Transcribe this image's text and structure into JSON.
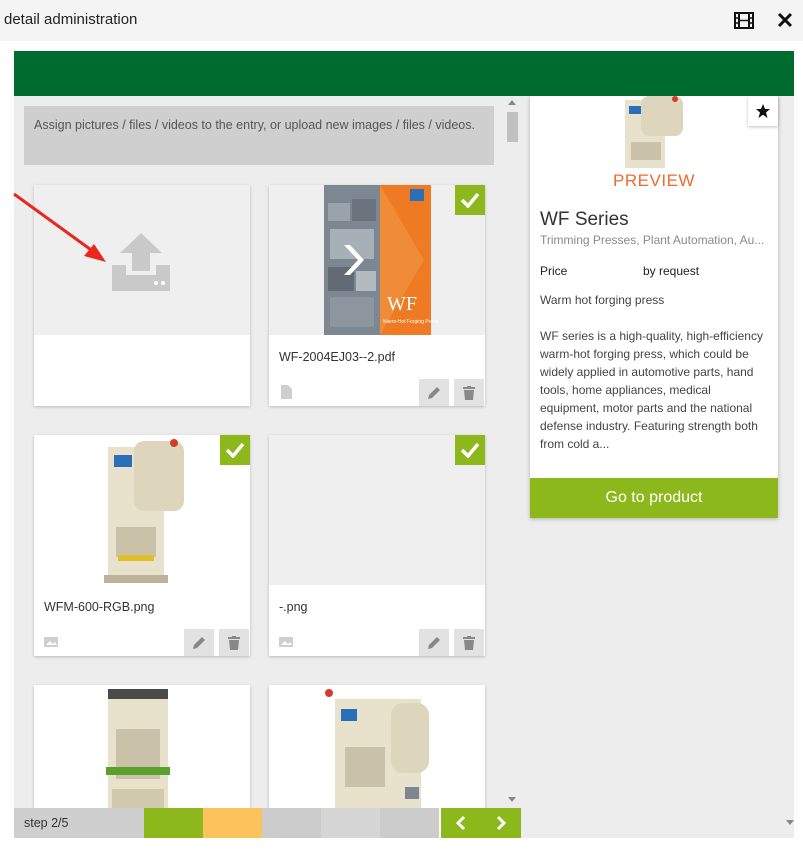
{
  "header": {
    "title": "detail administration",
    "film_icon": "film-icon",
    "close_icon": "close-icon"
  },
  "colors": {
    "brand_green": "#006b2e",
    "accent_green": "#8cb81c",
    "preview_orange": "#ee6b2f",
    "step_yellow": "#fcc25c"
  },
  "info_text": "Assign pictures / files / videos to the entry, or upload new images / files / videos.",
  "files": [
    {
      "name": "WF-2004EJ03--2.pdf",
      "type_icon": "document-icon",
      "selected": true
    },
    {
      "name": "WFM-600-RGB.png",
      "type_icon": "image-icon",
      "selected": true
    },
    {
      "name": "-.png",
      "type_icon": "image-icon",
      "selected": true
    }
  ],
  "preview": {
    "label": "PREVIEW",
    "title": "WF Series",
    "subtitle": "Trimming Presses, Plant Automation, Au...",
    "price_label": "Price",
    "price_value": "by request",
    "tagline": "Warm hot forging press",
    "description": "WF series is a high-quality, high-efficiency warm-hot forging press, which could be widely applied in automotive parts, hand tools, home appliances, medical equipment, motor parts and the national defense industry. Featuring strength both from cold a...",
    "button_label": "Go to product"
  },
  "pdf_thumb": {
    "brand": "WF",
    "caption": "Warm-Hot Forging Press"
  },
  "stepper": {
    "label": "step 2/5",
    "segments": [
      "#8cb81c",
      "#fcc25c",
      "#cccccc",
      "#d6d6d6",
      "#cccccc"
    ]
  }
}
